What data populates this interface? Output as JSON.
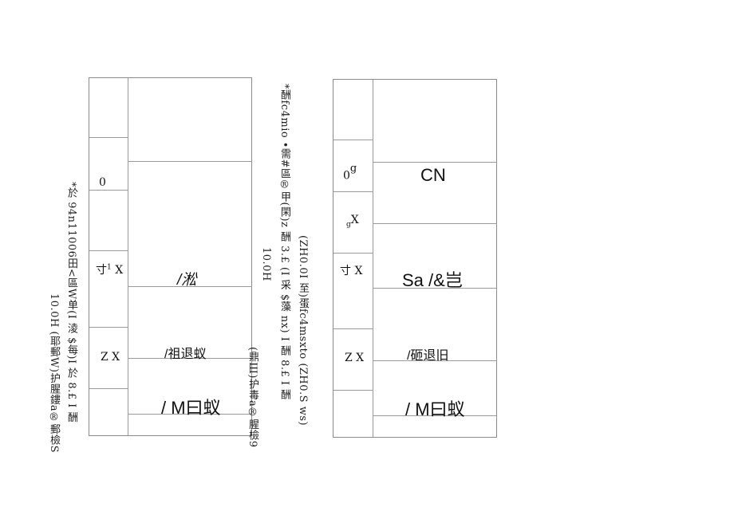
{
  "left_annotation": {
    "line1": "*於 94n11006田<區W单(I 淩 $每)I 於 8.£ I 酬",
    "line2": "10.0H (耶郵W)护腥鏤a®郵檢S"
  },
  "middle_annotation": {
    "line1": "*酬fc4mio •需#區®甲(閑)z 酬 3.£ (I 采 $藻 nx) I 酬 8.£ I 酬",
    "line2": "(ZH0.0I 至)蛋fc4msxto (ZH0.S ws)",
    "line3": "10.0H",
    "line4": "(鼎Ш)护毒a®腥檢9"
  },
  "table_left": {
    "col1": {
      "r2": "0",
      "r4_main": "寸",
      "r4_sup": "1",
      "r4_tail": "X",
      "r5": "Z X"
    },
    "col2": {
      "r_a": "/淞",
      "r_b": "/祖退蚁",
      "r_c": "/ M曰蚁"
    }
  },
  "table_right": {
    "col1": {
      "r2_main": "0",
      "r2_sup": "g",
      "r3_sub": "g",
      "r3_main": "X",
      "r4": "寸 X",
      "r5": "Z X"
    },
    "col2": {
      "r_a": "CN",
      "r_b": "Sa /&岂",
      "r_c": "/砸退旧",
      "r_d": "/ M曰蚁"
    }
  }
}
